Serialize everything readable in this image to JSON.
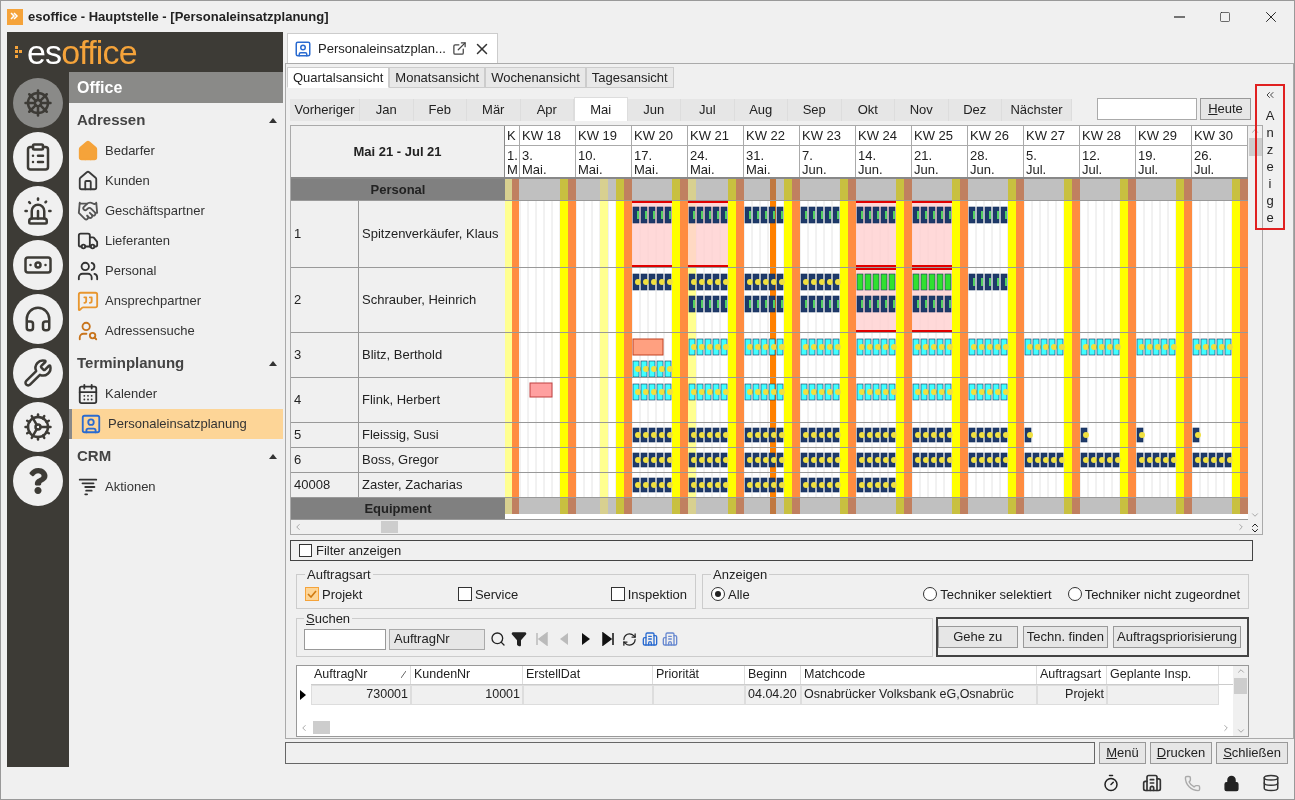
{
  "window": {
    "title": "esoffice - Hauptstelle - [Personaleinsatzplanung]"
  },
  "logo": {
    "prefix": "es",
    "suffix": "office"
  },
  "rail": [
    {
      "selected": true
    },
    {
      "selected": false
    },
    {
      "selected": false
    },
    {
      "selected": false
    },
    {
      "selected": false
    },
    {
      "selected": false
    },
    {
      "selected": false
    },
    {
      "selected": false
    }
  ],
  "nav": {
    "header": "Office",
    "sections": [
      {
        "title": "Adressen",
        "expanded": true,
        "items": [
          {
            "label": "Bedarfer",
            "selected": false
          },
          {
            "label": "Kunden",
            "selected": false
          },
          {
            "label": "Geschäftspartner",
            "selected": false
          },
          {
            "label": "Lieferanten",
            "selected": false
          },
          {
            "label": "Personal",
            "selected": false
          },
          {
            "label": "Ansprechpartner",
            "selected": false
          },
          {
            "label": "Adressensuche",
            "selected": false
          }
        ]
      },
      {
        "title": "Terminplanung",
        "expanded": true,
        "items": [
          {
            "label": "Kalender",
            "selected": false
          },
          {
            "label": "Personaleinsatzplanung",
            "selected": true
          }
        ]
      },
      {
        "title": "CRM",
        "expanded": true,
        "items": [
          {
            "label": "Aktionen",
            "selected": false
          }
        ]
      }
    ]
  },
  "document_tab": {
    "title": "Personaleinsatzplan..."
  },
  "view_tabs": [
    {
      "label": "Quartalsansicht",
      "selected": true
    },
    {
      "label": "Monatsansicht",
      "selected": false
    },
    {
      "label": "Wochenansicht",
      "selected": false
    },
    {
      "label": "Tagesansicht",
      "selected": false
    }
  ],
  "months": [
    {
      "label": "Vorheriger",
      "selected": false
    },
    {
      "label": "Jan",
      "selected": false
    },
    {
      "label": "Feb",
      "selected": false
    },
    {
      "label": "Mär",
      "selected": false
    },
    {
      "label": "Apr",
      "selected": false
    },
    {
      "label": "Mai",
      "selected": true
    },
    {
      "label": "Jun",
      "selected": false
    },
    {
      "label": "Jul",
      "selected": false
    },
    {
      "label": "Aug",
      "selected": false
    },
    {
      "label": "Sep",
      "selected": false
    },
    {
      "label": "Okt",
      "selected": false
    },
    {
      "label": "Nov",
      "selected": false
    },
    {
      "label": "Dez",
      "selected": false
    },
    {
      "label": "Nächster",
      "selected": false
    }
  ],
  "today_button": "Heute",
  "side_panel": {
    "label": "Anzeige"
  },
  "planner": {
    "range": "Mai 21 - Jul 21",
    "weeks": [
      {
        "label": "K",
        "day": "1.",
        "month": "M"
      },
      {
        "label": "KW 18",
        "day": "3.",
        "month": "Mai."
      },
      {
        "label": "KW 19",
        "day": "10.",
        "month": "Mai."
      },
      {
        "label": "KW 20",
        "day": "17.",
        "month": "Mai."
      },
      {
        "label": "KW 21",
        "day": "24.",
        "month": "Mai."
      },
      {
        "label": "KW 22",
        "day": "31.",
        "month": "Mai."
      },
      {
        "label": "KW 23",
        "day": "7.",
        "month": "Jun."
      },
      {
        "label": "KW 24",
        "day": "14.",
        "month": "Jun."
      },
      {
        "label": "KW 25",
        "day": "21.",
        "month": "Jun."
      },
      {
        "label": "KW 26",
        "day": "28.",
        "month": "Jun."
      },
      {
        "label": "KW 27",
        "day": "5.",
        "month": "Jul."
      },
      {
        "label": "KW 28",
        "day": "12.",
        "month": "Jul."
      },
      {
        "label": "KW 29",
        "day": "19.",
        "month": "Jul."
      },
      {
        "label": "KW 30",
        "day": "26.",
        "month": "Jul."
      }
    ],
    "groups": [
      {
        "title": "Personal",
        "rows": [
          {
            "number": "1",
            "name": "Spitzenverkäufer, Klaus"
          },
          {
            "number": "2",
            "name": "Schrauber, Heinrich"
          },
          {
            "number": "3",
            "name": "Blitz, Berthold"
          },
          {
            "number": "4",
            "name": "Flink, Herbert"
          },
          {
            "number": "5",
            "name": "Fleissig, Susi"
          },
          {
            "number": "6",
            "name": "Boss, Gregor"
          },
          {
            "number": "40008",
            "name": "Zaster, Zacharias"
          }
        ]
      },
      {
        "title": "Equipment"
      }
    ]
  },
  "filter": {
    "label": "Filter anzeigen",
    "checked": false
  },
  "order_type": {
    "title": "Auftragsart",
    "options": [
      {
        "label": "Projekt",
        "checked": true
      },
      {
        "label": "Service",
        "checked": false
      },
      {
        "label": "Inspektion",
        "checked": false
      }
    ]
  },
  "display": {
    "title": "Anzeigen",
    "options": [
      {
        "label": "Alle",
        "selected": true
      },
      {
        "label": "Techniker selektiert",
        "selected": false
      },
      {
        "label": "Techniker nicht zugeordnet",
        "selected": false
      }
    ]
  },
  "search": {
    "title": "Suchen",
    "field": "AuftragNr"
  },
  "actions": [
    "Gehe zu",
    "Techn. finden",
    "Auftragspriorisierung"
  ],
  "orders": {
    "columns": [
      "AuftragNr",
      "KundenNr",
      "ErstellDat",
      "Priorität",
      "Beginn",
      "Matchcode",
      "Auftragsart",
      "Geplante Insp."
    ],
    "rows": [
      {
        "selected": true,
        "cells": [
          "730001",
          "10001",
          null,
          null,
          "04.04.20",
          "Osnabrücker Volksbank eG,Osnabrüc",
          "Projekt",
          null
        ]
      }
    ]
  },
  "bottom_buttons": [
    "Menü",
    "Drucken",
    "Schließen"
  ]
}
